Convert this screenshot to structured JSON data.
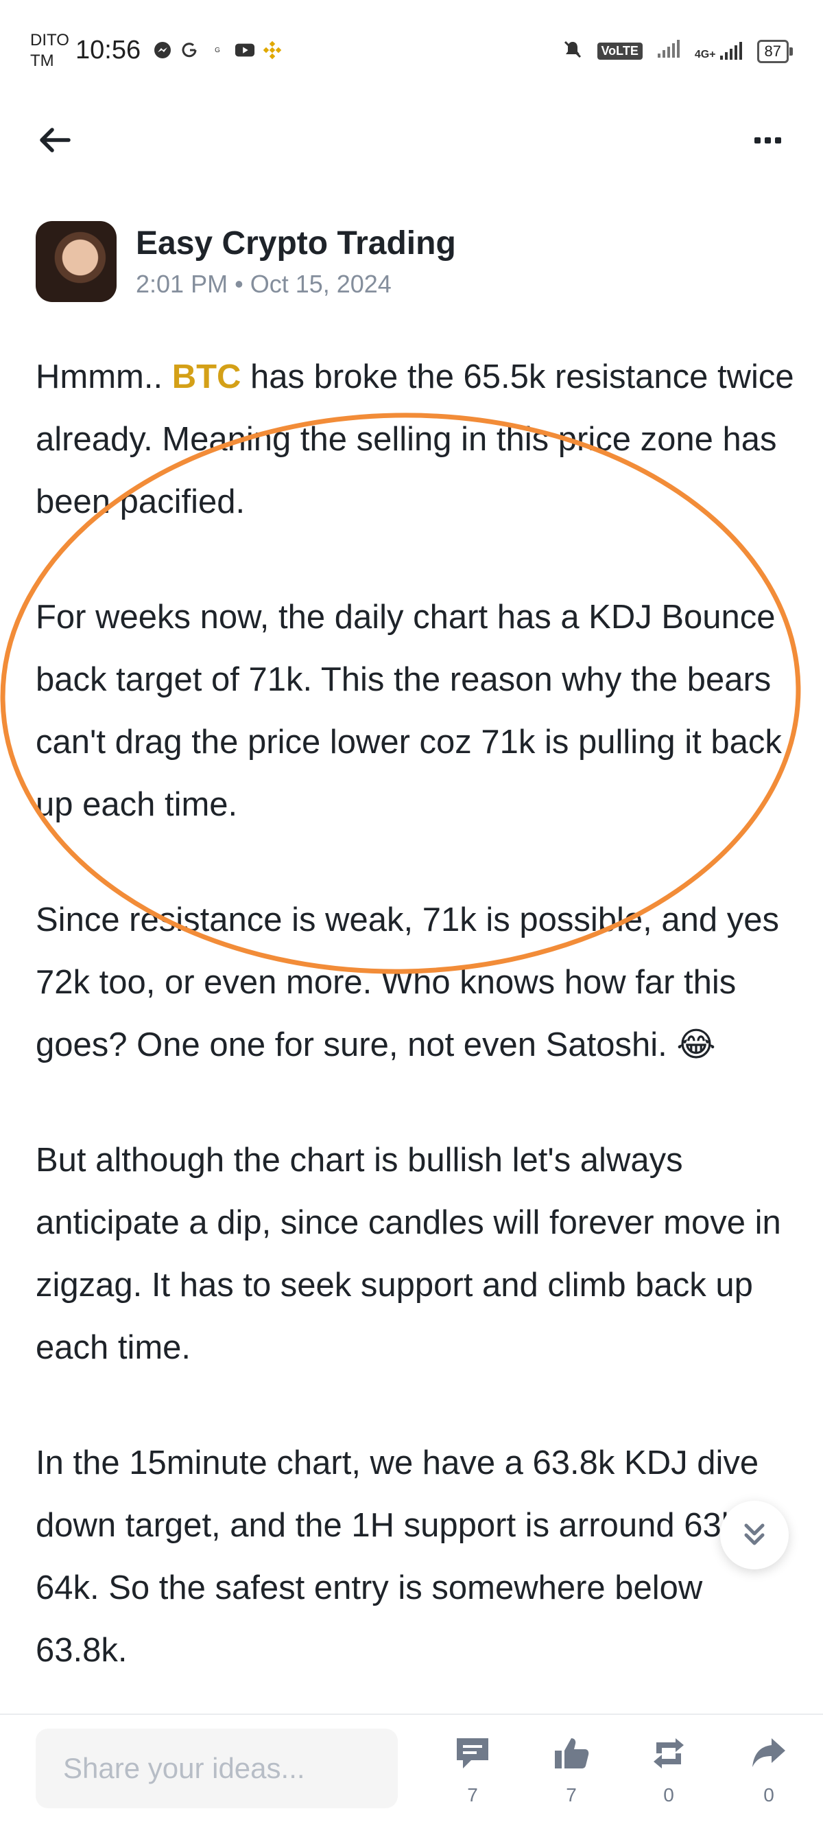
{
  "status_bar": {
    "carrier_line1": "DITO",
    "carrier_line2": "TM",
    "time": "10:56",
    "volte": "VoLTE",
    "network": "4G+",
    "battery": "87"
  },
  "nav": {
    "back": "back-arrow-icon",
    "more": "more-options-icon"
  },
  "author": {
    "name": "Easy Crypto Trading",
    "time": "2:01 PM",
    "date": "Oct 15, 2024"
  },
  "post": {
    "p1_a": "Hmmm.. ",
    "p1_ticker": "BTC",
    "p1_b": " has broke the 65.5k resistance twice already.  Meaning the selling in this price zone has been pacified.",
    "p2": "For weeks now, the daily chart has a KDJ Bounce back target of 71k.  This the reason why the bears can't drag the price lower coz 71k is pulling it back up each time.",
    "p3": "Since resistance is weak, 71k is possible, and yes 72k too, or even more.  Who knows how far this goes? One one for sure, not even Satoshi. 😂",
    "p4": "But although the chart is bullish let's always anticipate a dip, since candles will forever move in zigzag.  It has to seek support and climb back up each time.",
    "p5": "In the 15minute chart, we have a 63.8k KDJ dive down target, and the 1H support is arround 63k-64k.  So the safest entry is somewhere below 63.8k."
  },
  "bottom_bar": {
    "input_placeholder": "Share your ideas...",
    "comments_count": "7",
    "likes_count": "7",
    "reposts_count": "0",
    "shares_count": "0"
  },
  "colors": {
    "ticker": "#d4a017",
    "annotation": "#f28c38",
    "muted": "#848e9c"
  }
}
